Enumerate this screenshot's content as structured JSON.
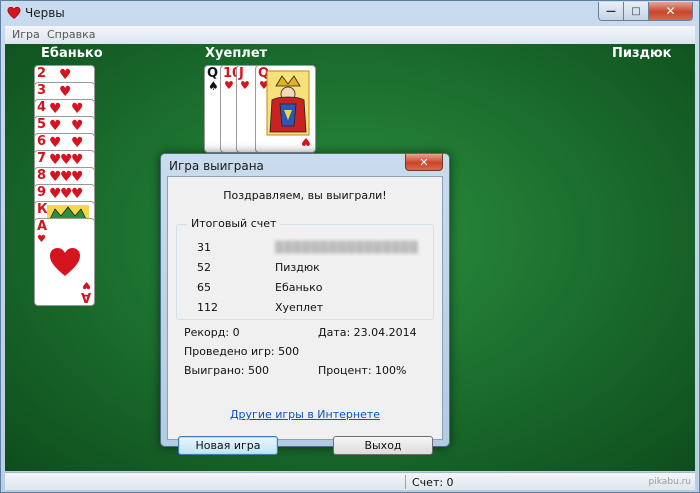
{
  "window": {
    "title": "Червы",
    "minimize_glyph": "—",
    "maximize_glyph": "□",
    "close_glyph": "✕"
  },
  "menu": {
    "items": [
      "Игра",
      "Справка"
    ]
  },
  "players": {
    "left": "Ебанько",
    "top": "Хуеплет",
    "right": "Пиздюк"
  },
  "left_stack": {
    "ranks": [
      "2",
      "3",
      "4",
      "5",
      "6",
      "7",
      "8",
      "9",
      "К",
      "А"
    ],
    "suit_glyph": "♥"
  },
  "center_trick": {
    "ranks": [
      "Q",
      "10",
      "J",
      "Q"
    ]
  },
  "dialog": {
    "title": "Игра выиграна",
    "close_glyph": "✕",
    "congrats": "Поздравляем, вы выиграли!",
    "group_title": "Итоговый счет",
    "scores": [
      {
        "points": "31",
        "name": "▒▒▒▒▒▒▒▒▒▒▒▒▒▒▒▒",
        "blurred": true
      },
      {
        "points": "52",
        "name": "Пиздюк"
      },
      {
        "points": "65",
        "name": "Ебанько"
      },
      {
        "points": "112",
        "name": "Хуеплет"
      }
    ],
    "record": "Рекорд: 0",
    "date": "Дата: 23.04.2014",
    "played": "Проведено игр: 500",
    "won": "Выиграно: 500",
    "percent": "Процент: 100%",
    "link": "Другие игры в Интернете",
    "new_game_label": "Новая игра",
    "exit_label": "Выход"
  },
  "status": {
    "score": "Счет: 0",
    "watermark": "pikabu.ru"
  },
  "colors": {
    "felt": "#1d7230",
    "heart_red": "#d5141f",
    "link_blue": "#0a52c5"
  }
}
